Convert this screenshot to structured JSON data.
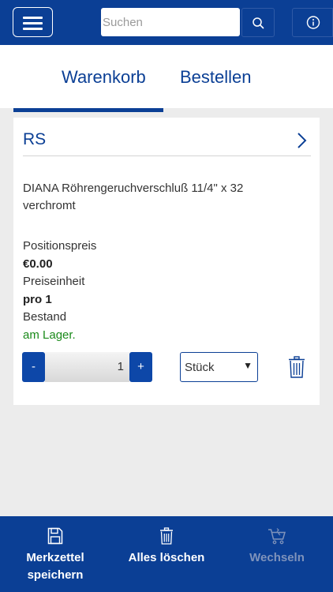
{
  "header": {
    "search_placeholder": "Suchen"
  },
  "tabs": [
    {
      "label": "Warenkorb",
      "active": true
    },
    {
      "label": "Bestellen",
      "active": false
    }
  ],
  "cart_item": {
    "group_title": "RS",
    "product_name": "DIANA Röhrengeruchverschluß 11/4\" x 32 verchromt",
    "position_price_label": "Positionspreis",
    "position_price_value": "€0.00",
    "price_unit_label": "Preiseinheit",
    "price_unit_value": "pro 1",
    "stock_label": "Bestand",
    "stock_value": "am Lager.",
    "quantity": "1",
    "minus_label": "-",
    "plus_label": "+",
    "unit": "Stück"
  },
  "bottom_bar": {
    "save_label_line1": "Merkzettel",
    "save_label_line2": "speichern",
    "clear_label": "Alles löschen",
    "switch_label": "Wechseln"
  },
  "colors": {
    "brand_blue": "#0b3f95",
    "stock_green": "#1a8a1a",
    "disabled_text": "#7f93bb"
  }
}
